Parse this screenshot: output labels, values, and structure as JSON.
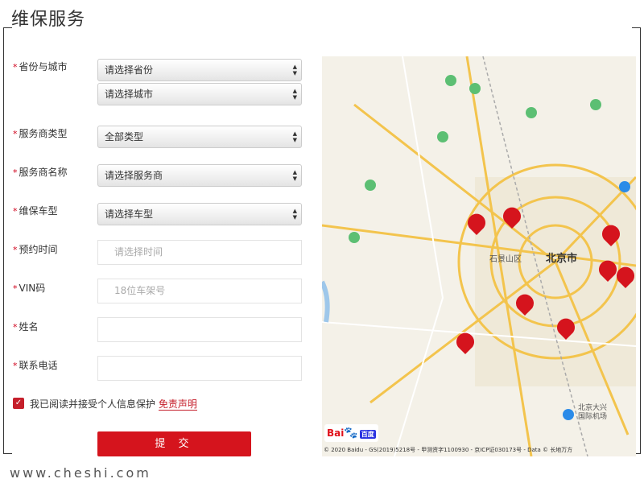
{
  "page": {
    "title": "维保服务",
    "watermark": "www.cheshi.com"
  },
  "form": {
    "required_mark": "*",
    "province_city": {
      "label": "省份与城市",
      "province_value": "请选择省份",
      "city_value": "请选择城市"
    },
    "dealer_type": {
      "label": "服务商类型",
      "value": "全部类型"
    },
    "dealer_name": {
      "label": "服务商名称",
      "value": "请选择服务商"
    },
    "car_model": {
      "label": "维保车型",
      "value": "请选择车型"
    },
    "appointment_time": {
      "label": "预约时间",
      "placeholder": "请选择时间"
    },
    "vin": {
      "label": "VIN码",
      "placeholder": "18位车架号"
    },
    "name": {
      "label": "姓名",
      "placeholder": ""
    },
    "phone": {
      "label": "联系电话",
      "placeholder": ""
    },
    "agreement": {
      "checked": true,
      "text": "我已阅读并接受个人信息保护",
      "link": "免责声明"
    },
    "submit_label": "提 交"
  },
  "map": {
    "city_label": "北京市",
    "district_label": "石景山区",
    "airport_label": "北京大兴国际机场",
    "logo": {
      "part1": "Bai",
      "paw": "🐾",
      "part2": "百度"
    },
    "copyright": "© 2020 Baidu - GS(2019)5218号 - 甲测资字1100930 - 京ICP证030173号 - Data © 长地万方",
    "marker_count": 8
  }
}
